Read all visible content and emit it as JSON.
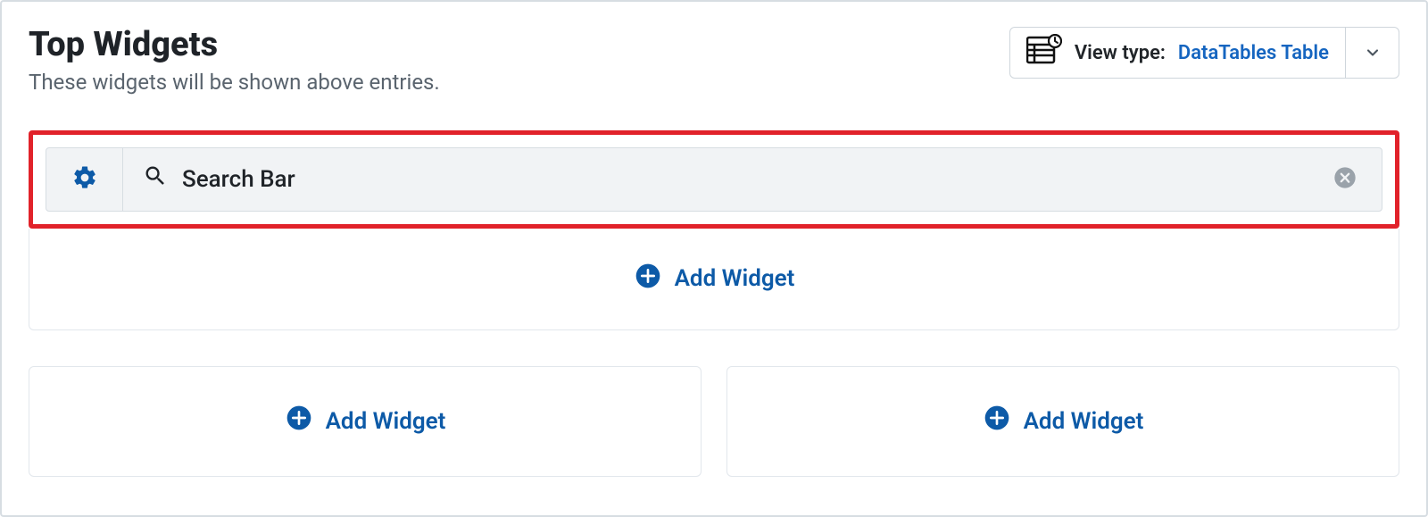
{
  "header": {
    "title": "Top Widgets",
    "subtitle": "These widgets will be shown above entries."
  },
  "view_type": {
    "label": "View type: ",
    "value": "DataTables Table"
  },
  "widget_rows": [
    {
      "label": "Search Bar"
    }
  ],
  "buttons": {
    "add_widget": "Add Widget"
  }
}
